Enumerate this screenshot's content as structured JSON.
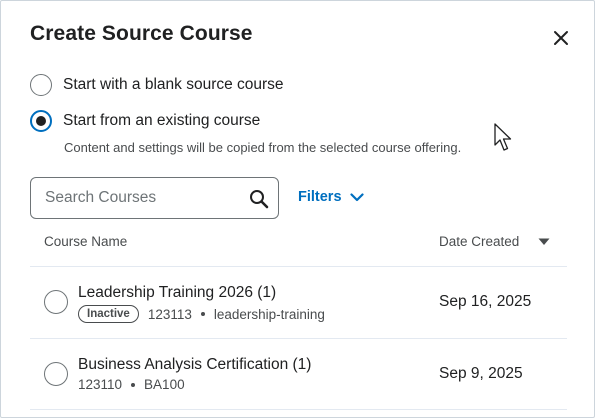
{
  "dialog": {
    "title": "Create Source Course",
    "close_icon": "close-icon"
  },
  "options": [
    {
      "label": "Start with a blank source course",
      "selected": false
    },
    {
      "label": "Start from an existing course",
      "selected": true
    }
  ],
  "helper_text": "Content and settings will be copied from the selected course offering.",
  "search": {
    "placeholder": "Search Courses",
    "value": "",
    "icon": "search-icon"
  },
  "filters": {
    "label": "Filters",
    "icon": "chevron-down-icon"
  },
  "table": {
    "columns": [
      "Course Name",
      "Date Created"
    ],
    "sort_icon": "sort-descending-icon",
    "rows": [
      {
        "name": "Leadership Training 2026 (1)",
        "badge": "Inactive",
        "code": "123113",
        "tag": "leadership-training",
        "date": "Sep 16, 2025",
        "selected": false
      },
      {
        "name": "Business Analysis Certification (1)",
        "badge": "",
        "code": "123110",
        "tag": "BA100",
        "date": "Sep 9, 2025",
        "selected": false
      }
    ]
  },
  "colors": {
    "accent": "#006fbf",
    "text": "#202122",
    "muted": "#494c4e",
    "border": "#6e7477"
  }
}
